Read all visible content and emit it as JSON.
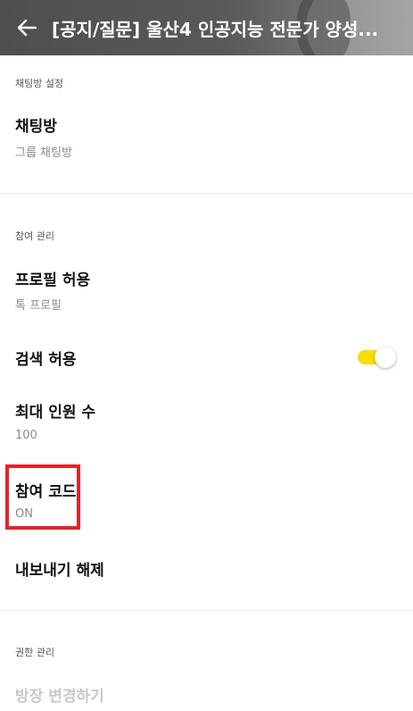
{
  "header": {
    "title": "[공지/질문] 울산4 인공지능 전문가 양성...",
    "back_icon": "arrow-left-icon"
  },
  "sections": {
    "chatroom_settings": {
      "label": "채팅방 설정",
      "items": [
        {
          "title": "채팅방",
          "subtitle": "그룹 채팅방"
        }
      ]
    },
    "participation": {
      "label": "참여 관리",
      "profile": {
        "title": "프로필 허용",
        "subtitle": "톡 프로필"
      },
      "search": {
        "title": "검색 허용",
        "toggle_on": true
      },
      "max_members": {
        "title": "최대 인원 수",
        "subtitle": "100"
      },
      "join_code": {
        "title": "참여 코드",
        "subtitle": "ON"
      },
      "export": {
        "title": "내보내기 해제"
      }
    },
    "permissions": {
      "label": "권한 관리",
      "transfer_owner": {
        "title": "방장 변경하기"
      }
    }
  },
  "colors": {
    "toggle_on": "#fbdc00",
    "highlight": "#e5222b",
    "disabled_text": "#c8c8c8"
  }
}
